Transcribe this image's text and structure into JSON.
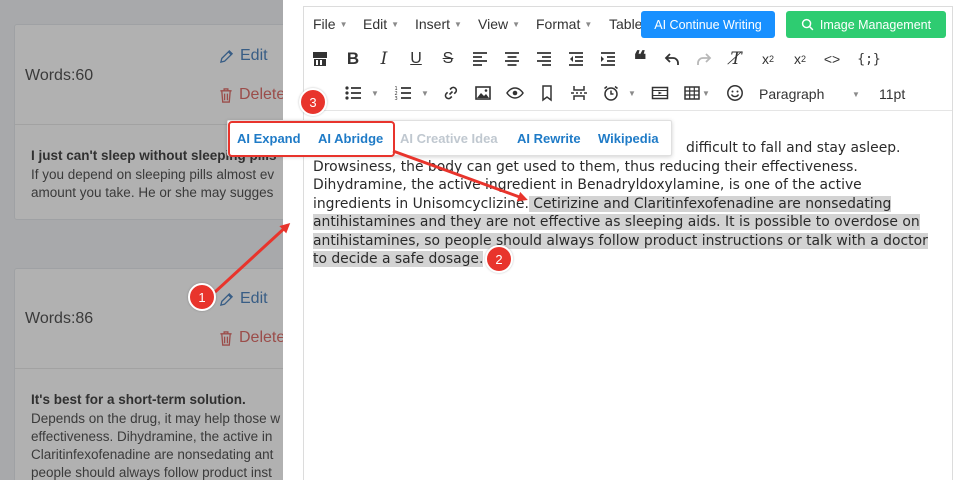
{
  "cards": [
    {
      "words": "Words:60",
      "edit_label": "Edit",
      "delete_label": "Delete",
      "title": "I just can't sleep without sleeping pills",
      "body": [
        "If you depend on sleeping pills almost ev",
        "amount you take. He or she may sugges"
      ]
    },
    {
      "words": "Words:86",
      "edit_label": "Edit",
      "delete_label": "Delete",
      "title": "It's best for a short-term solution.",
      "body": [
        "Depends on the drug, it may help those w",
        "effectiveness. Dihydramine, the active in",
        "Claritinfexofenadine are nonsedating ant",
        "people should always follow product inst"
      ]
    }
  ],
  "editor": {
    "menu": [
      "File",
      "Edit",
      "Insert",
      "View",
      "Format",
      "Table"
    ],
    "ai_button": "AI Continue Writing",
    "image_button": "Image Management",
    "paragraph_select": "Paragraph",
    "font_size": "11pt",
    "content": {
      "line1_tail": "difficult to fall and stay asleep.",
      "line2": "Drowsiness, the body can get used to them, thus reducing their effectiveness.",
      "line3": "Dihydramine, the active ingredient in Benadryldoxylamine, is one of the active",
      "line4_plain": "ingredients in Unisomcyclizine.",
      "line4_selected": "Cetirizine and Claritinfexofenadine are nonsedating",
      "line5": "antihistamines and they are not effective as sleeping aids. It is possible to overdose on",
      "line6": "antihistamines, so people should always follow product instructions or talk with a doctor",
      "line7": "to decide a safe dosage."
    }
  },
  "ai_menu": {
    "items": [
      "AI Expand",
      "AI Abridge",
      "AI Creative Idea",
      "AI Rewrite",
      "Wikipedia"
    ]
  },
  "annotations": {
    "badges": [
      "1",
      "2",
      "3"
    ],
    "color": "#e8342c"
  },
  "colors": {
    "primary": "#1890ff",
    "success": "#2ecc71",
    "link": "#2f6fb4",
    "danger": "#d9534f"
  }
}
